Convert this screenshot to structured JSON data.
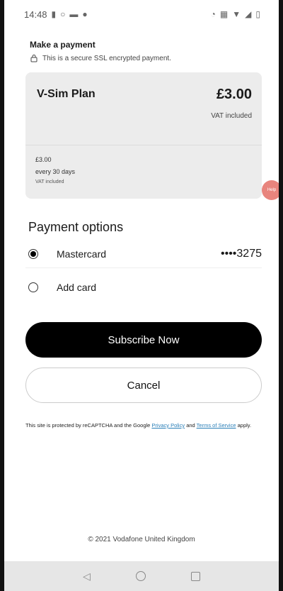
{
  "status_bar": {
    "time": "14:48",
    "left_icons": [
      "sim-icon",
      "search-icon",
      "message-icon",
      "settings-icon"
    ],
    "right_icons": [
      "alarm-icon",
      "vibrate-icon",
      "wifi-icon",
      "signal-icon",
      "battery-icon"
    ]
  },
  "payment": {
    "title": "Make a payment",
    "secure_text": "This is a secure SSL encrypted payment."
  },
  "plan": {
    "name": "V-Sim Plan",
    "price": "£3.00",
    "vat_label": "VAT included",
    "detail_price": "£3.00",
    "detail_period": "every 30 days",
    "detail_vat": "VAT included"
  },
  "fab": {
    "label": "Help"
  },
  "payment_options": {
    "title": "Payment options",
    "options": [
      {
        "label": "Mastercard",
        "selected": true,
        "masked_number": "••••3275"
      },
      {
        "label": "Add card",
        "selected": false
      }
    ]
  },
  "buttons": {
    "subscribe": "Subscribe Now",
    "cancel": "Cancel"
  },
  "legal": {
    "prefix": "This site is protected by reCAPTCHA and the Google ",
    "privacy_link": "Privacy Policy",
    "and": " and ",
    "terms_link": "Terms of Service",
    "suffix": " apply."
  },
  "footer": {
    "copyright": "© 2021 Vodafone United Kingdom"
  },
  "nav": {
    "back": "◁",
    "home": "home",
    "recents": "recents"
  }
}
